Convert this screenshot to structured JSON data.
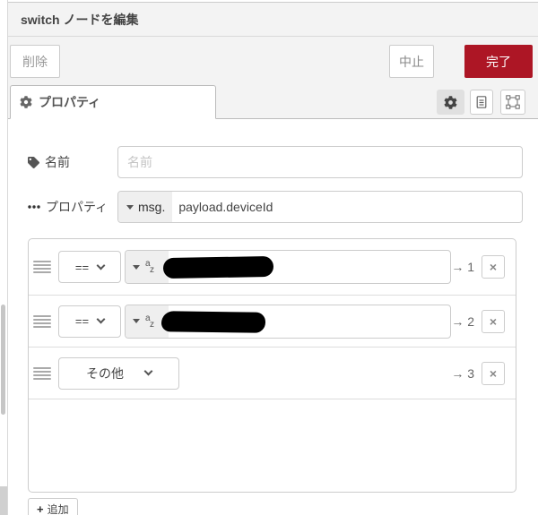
{
  "window": {
    "title": "switch ノードを編集"
  },
  "toolbar": {
    "delete_label": "削除",
    "cancel_label": "中止",
    "done_label": "完了"
  },
  "tabbar": {
    "properties_tab_label": "プロパティ"
  },
  "form": {
    "name_label": "名前",
    "name_placeholder": "名前",
    "property_label": "プロパティ",
    "property_prefix": "msg.",
    "property_value": "payload.deviceId"
  },
  "rules": [
    {
      "operator": "==",
      "value_type": "string",
      "value_redacted": true,
      "output_label": "→ 1"
    },
    {
      "operator": "==",
      "value_type": "string",
      "value_redacted": true,
      "output_label": "→ 2"
    },
    {
      "operator": "その他",
      "output_label": "→ 3"
    }
  ],
  "rule_row": {
    "close_label": "×"
  },
  "footer": {
    "add_plus": "+",
    "add_label": "追加"
  },
  "icons": {
    "az_top": "a",
    "az_bottom": "z"
  },
  "colors": {
    "accent_red": "#AD1625",
    "panel_gray": "#f3f3f3",
    "border_gray": "#cccccc",
    "redaction_black": "#000000"
  }
}
